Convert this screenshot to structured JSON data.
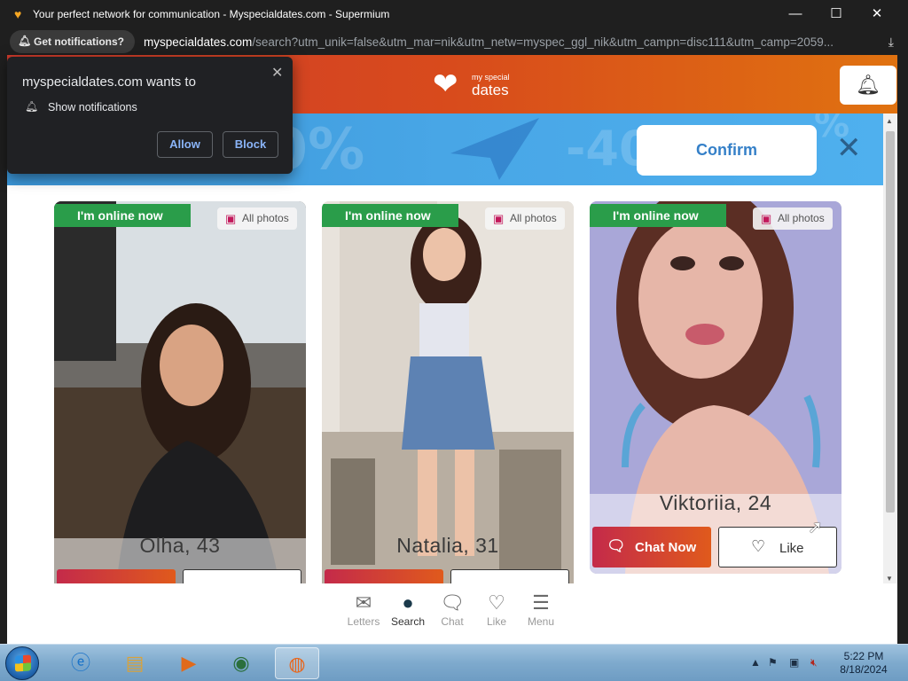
{
  "window": {
    "title": "Your perfect network for communication - Myspecialdates.com - Supermium",
    "minimize": "—",
    "maximize": "☐",
    "close": "✕"
  },
  "addressbar": {
    "notif_pill": "Get notifications?",
    "url_host": "myspecialdates.com",
    "url_path": "/search?utm_unik=false&utm_mar=nik&utm_netw=myspec_ggl_nik&utm_campn=disc111&utm_camp=2059..."
  },
  "notification_popup": {
    "host_text": "myspecialdates.com wants to",
    "permission": "Show notifications",
    "allow": "Allow",
    "block": "Block",
    "close": "✕"
  },
  "header": {
    "logo_small": "my special",
    "logo_large": "dates"
  },
  "banner": {
    "confirm": "Confirm",
    "bg_texts": [
      "70%",
      "-40%",
      "%"
    ]
  },
  "cards": [
    {
      "online": "I'm online now",
      "all_photos": "All photos",
      "name": "Olha, 43"
    },
    {
      "online": "I'm online now",
      "all_photos": "All photos",
      "name": "Natalia, 31"
    },
    {
      "online": "I'm online now",
      "all_photos": "All photos",
      "name": "Viktoriia, 24",
      "chat": "Chat Now",
      "like": "Like"
    }
  ],
  "bottom_nav": [
    {
      "label": "Letters",
      "icon": "envelope-icon"
    },
    {
      "label": "Search",
      "icon": "search-icon",
      "active": true
    },
    {
      "label": "Chat",
      "icon": "chat-icon"
    },
    {
      "label": "Like",
      "icon": "heart-icon"
    },
    {
      "label": "Menu",
      "icon": "menu-icon"
    }
  ],
  "taskbar": {
    "time": "5:22 PM",
    "date": "8/18/2024"
  },
  "colors": {
    "header_gradient": [
      "#cf3a2c",
      "#e07210"
    ],
    "online_badge": "#2a9d4a",
    "chat_button": [
      "#c42a4a",
      "#e05a1c"
    ],
    "banner": "#48a6e6",
    "confirm_text": "#3580c8"
  }
}
